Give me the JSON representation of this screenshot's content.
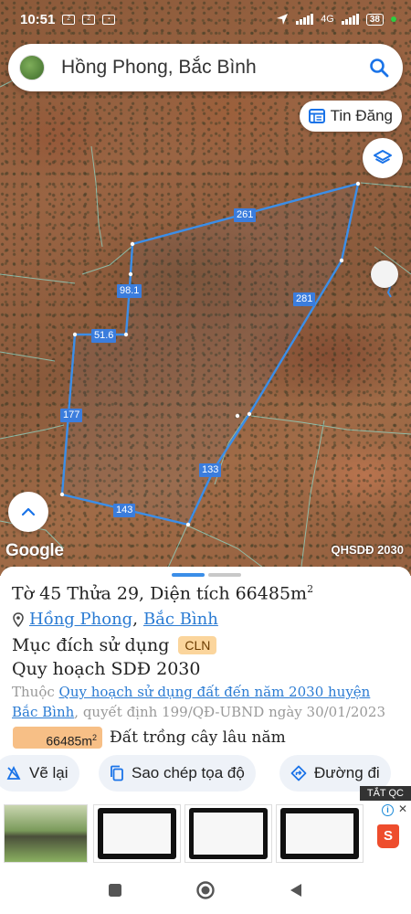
{
  "status_bar": {
    "time": "10:51",
    "network": "4G",
    "battery": "38"
  },
  "search": {
    "query": "Hồng Phong, Bắc Bình"
  },
  "map": {
    "tin_dang_label": "Tin Đăng",
    "attribution": "Google",
    "layer_tag": "QHSDĐ 2030",
    "edge_lengths": [
      "261",
      "98.1",
      "51.6",
      "177",
      "143",
      "133",
      "281"
    ]
  },
  "parcel": {
    "title": "Tờ 45 Thửa 29, Diện tích 66485m",
    "title_sup": "2",
    "commune": "Hồng Phong",
    "separator": ",",
    "district": "Bắc Bình",
    "purpose_label": "Mục đích sử dụng",
    "purpose_code": "CLN",
    "plan_label": "Quy hoạch SDĐ 2030",
    "desc_prefix": "Thuộc ",
    "plan_link": "Quy hoạch sử dụng đất đến năm 2030 huyện Bắc Bình",
    "desc_suffix": ", quyết định 199/QĐ-UBND ngày 30/01/2023",
    "area_value": "66485m",
    "area_sup": "2",
    "land_type": "Đất trồng cây lâu năm"
  },
  "actions": {
    "redraw": "Vẽ lại",
    "copy_coords": "Sao chép tọa độ",
    "directions": "Đường đi"
  },
  "ads": {
    "tag": "TẮT QC",
    "info": "i"
  },
  "colors": {
    "accent": "#3b7ddd",
    "link": "#2a7bd3",
    "badge": "#fbd59c",
    "area_pill": "#f7bf86",
    "chip_bg": "#eef2f8"
  }
}
